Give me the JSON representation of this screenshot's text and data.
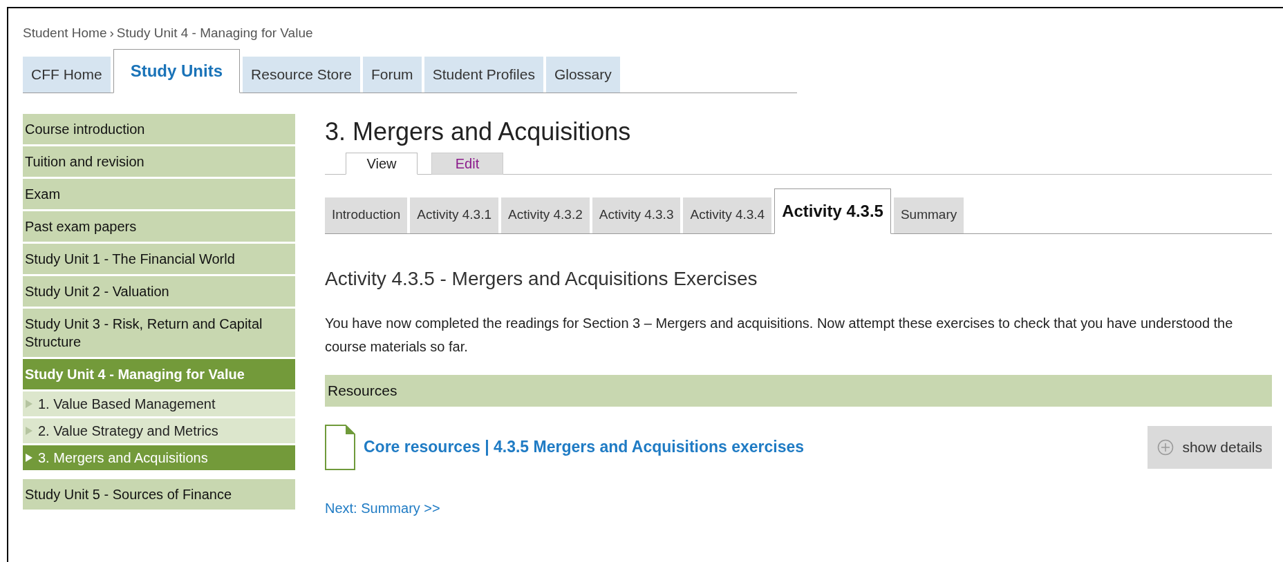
{
  "breadcrumb": [
    {
      "label": "Student Home"
    },
    {
      "label": "›"
    },
    {
      "label": "Study Unit 4 - Managing for Value"
    }
  ],
  "nav_tabs": [
    {
      "label": "CFF Home",
      "selected": false
    },
    {
      "label": "Study Units",
      "selected": true
    },
    {
      "label": "Resource Store",
      "selected": false
    },
    {
      "label": "Forum",
      "selected": false
    },
    {
      "label": "Student Profiles",
      "selected": false
    },
    {
      "label": "Glossary",
      "selected": false
    }
  ],
  "sidebar": {
    "items": [
      {
        "label": "Course introduction",
        "selected": false
      },
      {
        "label": "Tuition and revision",
        "selected": false
      },
      {
        "label": "Exam",
        "selected": false
      },
      {
        "label": "Past exam papers",
        "selected": false
      },
      {
        "label": "Study Unit 1 - The Financial World",
        "selected": false
      },
      {
        "label": "Study Unit 2 - Valuation",
        "selected": false
      },
      {
        "label": "Study Unit 3 - Risk, Return and Capital Structure",
        "selected": false
      },
      {
        "label": "Study Unit 4 - Managing for Value",
        "selected": true,
        "children": [
          {
            "label": "1. Value Based Management",
            "selected": false
          },
          {
            "label": "2. Value Strategy and Metrics",
            "selected": false
          },
          {
            "label": "3. Mergers and Acquisitions",
            "selected": true
          }
        ]
      },
      {
        "label": "Study Unit 5 - Sources of Finance",
        "selected": false
      }
    ]
  },
  "page_title": "3. Mergers and Acquisitions",
  "mode_tabs": [
    {
      "label": "View",
      "selected": true
    },
    {
      "label": "Edit",
      "selected": false
    }
  ],
  "section_tabs": [
    {
      "label": "Introduction",
      "selected": false
    },
    {
      "label": "Activity 4.3.1",
      "selected": false
    },
    {
      "label": "Activity 4.3.2",
      "selected": false
    },
    {
      "label": "Activity 4.3.3",
      "selected": false
    },
    {
      "label": "Activity 4.3.4",
      "selected": false
    },
    {
      "label": "Activity 4.3.5",
      "selected": true
    },
    {
      "label": "Summary",
      "selected": false
    }
  ],
  "activity_heading": "Activity 4.3.5 - Mergers and Acquisitions Exercises",
  "intro_text": "You have now completed the readings for Section 3 – Mergers and acquisitions. Now attempt these exercises to check that you have understood the course materials so far.",
  "resources": {
    "title": "Resources",
    "items": [
      {
        "label": "Core resources | 4.3.5 Mergers and Acquisitions exercises",
        "button": "show details"
      }
    ]
  },
  "next_link": "Next: Summary >>"
}
